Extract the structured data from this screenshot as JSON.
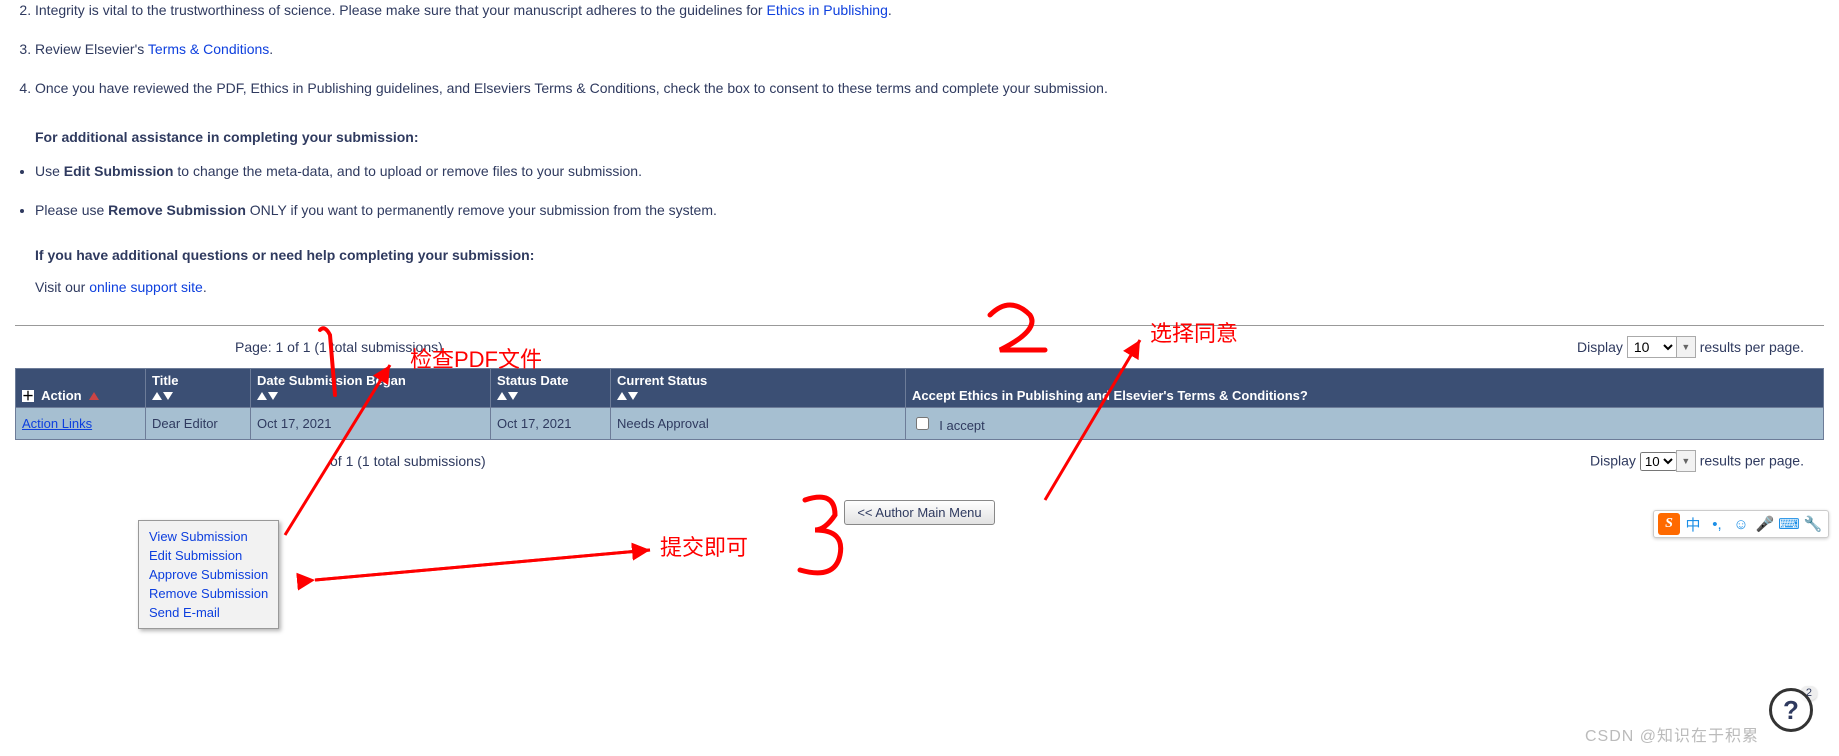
{
  "list2": {
    "prefix": "Integrity is vital to the trustworthiness of science. Please make sure that your manuscript adheres to the guidelines for ",
    "link": "Ethics in Publishing",
    "suffix": "."
  },
  "list3": {
    "prefix": "Review Elsevier's ",
    "link": "Terms & Conditions",
    "suffix": "."
  },
  "list4": "Once you have reviewed the PDF, Ethics in Publishing guidelines, and Elseviers Terms & Conditions, check the box to consent to these terms and complete your submission.",
  "assist_header": "For additional assistance in completing your submission:",
  "bullet1_a": "Use ",
  "bullet1_bold": "Edit Submission",
  "bullet1_b": " to change the meta-data, and to upload or remove files to your submission.",
  "bullet2_a": "Please use ",
  "bullet2_bold": "Remove Submission",
  "bullet2_b": " ONLY if you want to permanently remove your submission from the system.",
  "questions_header": "If you have additional questions or need help completing your submission:",
  "visit_prefix": "Visit our ",
  "visit_link": "online support site",
  "visit_suffix": ".",
  "page_info_top": "Page: 1 of 1 (1 total submissions)",
  "page_info_bottom": "of 1 (1 total submissions)",
  "display_label": "Display",
  "per_page_label": " results per page.",
  "per_page_value": "10",
  "table": {
    "headers": {
      "action": "Action",
      "title": "Title",
      "date_began": "Date Submission Began",
      "status_date": "Status Date",
      "current_status": "Current Status",
      "accept": "Accept Ethics in Publishing and Elsevier's Terms & Conditions?"
    },
    "row": {
      "action": "Action Links",
      "title": "Dear Editor",
      "date_began": "Oct 17, 2021",
      "status_date": "Oct 17, 2021",
      "current_status": "Needs Approval",
      "accept_label": "I accept"
    }
  },
  "menu": {
    "view": "View Submission",
    "edit": "Edit Submission",
    "approve": "Approve Submission",
    "remove": "Remove Submission",
    "send": "Send E-mail"
  },
  "main_menu_btn": "<< Author Main Menu",
  "anno": {
    "a1": "检查PDF文件",
    "a2": "选择同意",
    "a3": "提交即可",
    "n1": "1",
    "n2": "2",
    "n3": "3"
  },
  "ime": {
    "logo": "S",
    "cn": "中",
    "dot": "•,",
    "emoji": "☺",
    "mic": "🎤",
    "kbd": "⌨",
    "tool": "🔧"
  },
  "help": {
    "q": "?",
    "badge": "2"
  },
  "watermark": "CSDN @知识在于积累"
}
